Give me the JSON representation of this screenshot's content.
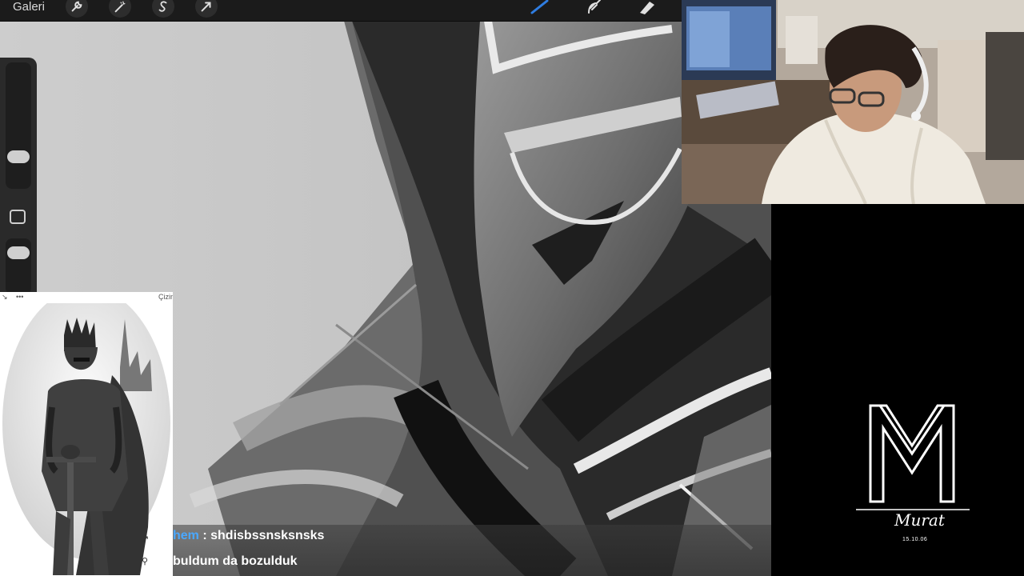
{
  "toolbar": {
    "gallery_label": "Galeri",
    "left_tools": [
      "wrench-icon",
      "magic-wand-icon",
      "selection-s-icon",
      "transform-arrow-icon"
    ],
    "right_tools": [
      "brush-icon",
      "smudge-icon",
      "eraser-icon"
    ],
    "active_color": "#2f7de1"
  },
  "reference_panel": {
    "top_left_icons": [
      "expand-icon",
      "more-dots-icon"
    ],
    "more_label": "•••",
    "top_right_label": "Çizim"
  },
  "chat": {
    "messages": [
      {
        "user": "hem",
        "separator": " : ",
        "text": "shdisbssnsksnsks"
      },
      {
        "user": "",
        "separator": "",
        "text": "buldum da bozulduk"
      }
    ]
  },
  "branding": {
    "signature": "Murat",
    "signature_date": "15.10.06"
  }
}
